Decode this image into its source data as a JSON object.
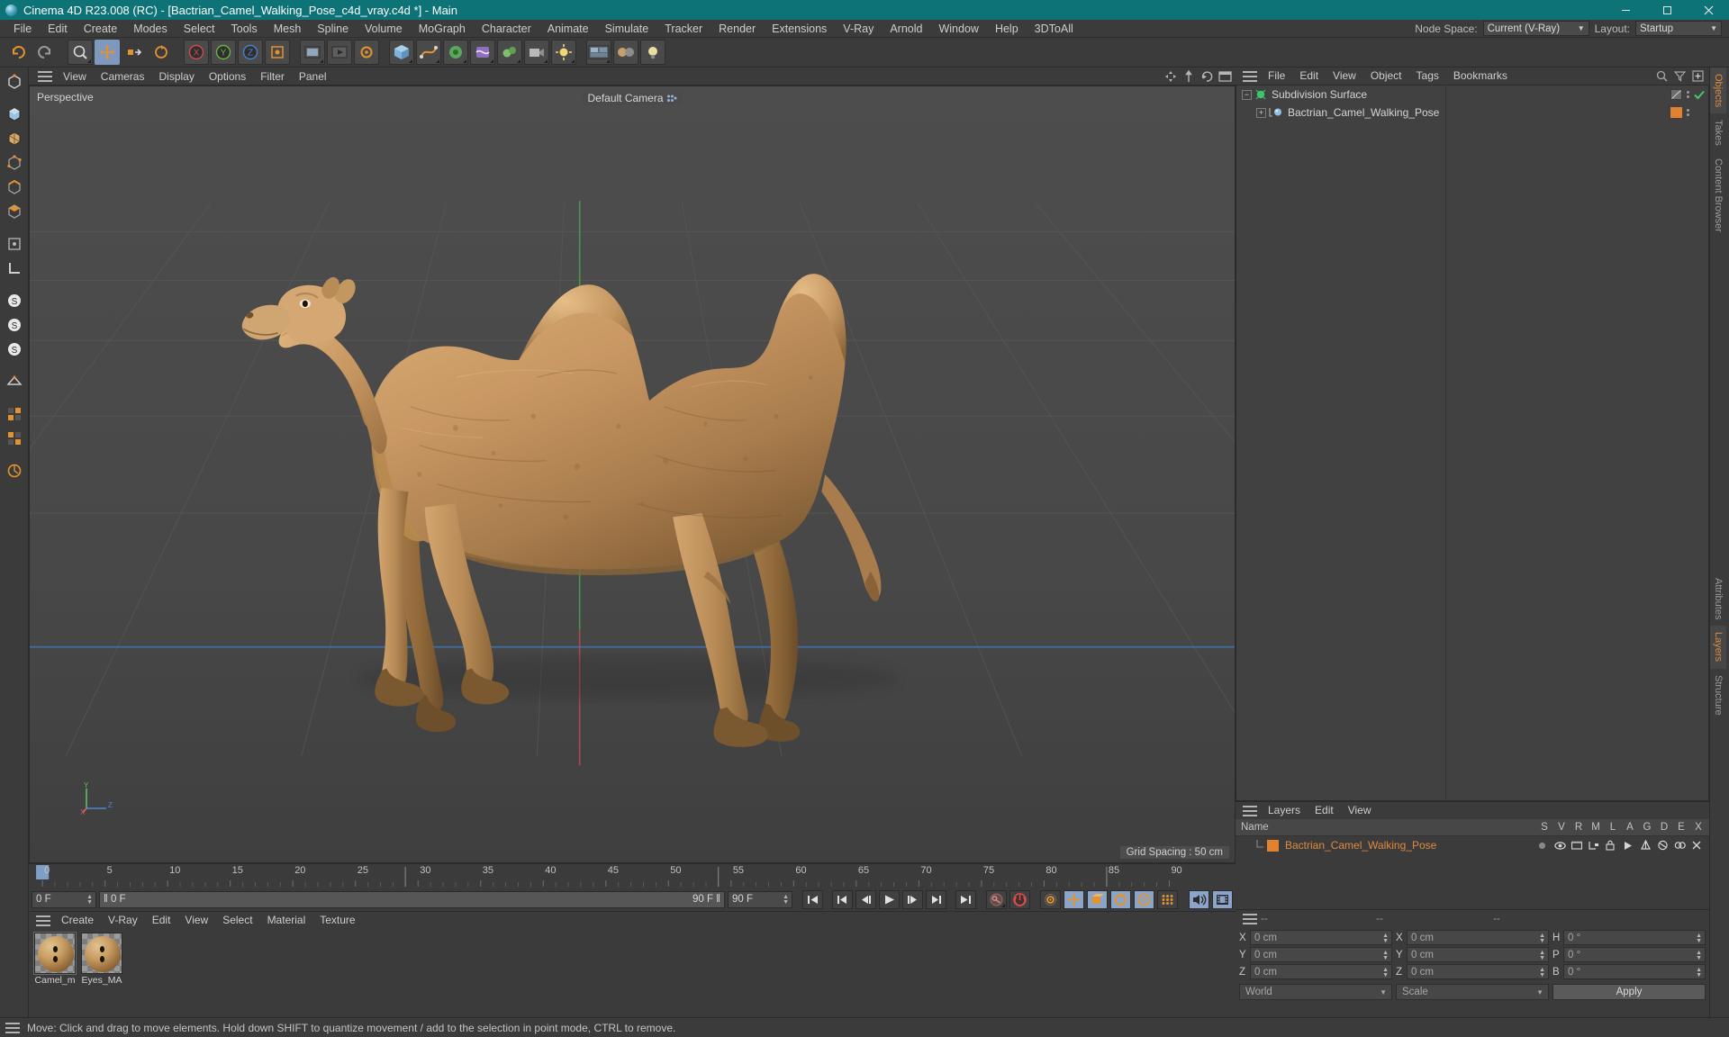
{
  "window": {
    "title": "Cinema 4D R23.008 (RC) - [Bactrian_Camel_Walking_Pose_c4d_vray.c4d *] - Main",
    "minimize": "—",
    "maximize": "▢",
    "close": "✕",
    "accent": "#0d7377"
  },
  "menubar": {
    "items": [
      "File",
      "Edit",
      "Create",
      "Modes",
      "Select",
      "Tools",
      "Mesh",
      "Spline",
      "Volume",
      "MoGraph",
      "Character",
      "Animate",
      "Simulate",
      "Tracker",
      "Render",
      "Extensions",
      "V-Ray",
      "Arnold",
      "Window",
      "Help",
      "3DToAll"
    ],
    "node_space_label": "Node Space:",
    "node_space_value": "Current (V-Ray)",
    "layout_label": "Layout:",
    "layout_value": "Startup"
  },
  "viewport": {
    "menu": [
      "View",
      "Cameras",
      "Display",
      "Options",
      "Filter",
      "Panel"
    ],
    "projection_label": "Perspective",
    "camera_label": "Default Camera",
    "grid_spacing": "Grid Spacing : 50 cm",
    "axis": {
      "x": "X",
      "y": "Y",
      "z": "Z"
    }
  },
  "timeline": {
    "ticks": [
      "0",
      "5",
      "10",
      "15",
      "20",
      "25",
      "30",
      "35",
      "40",
      "45",
      "50",
      "55",
      "60",
      "65",
      "70",
      "75",
      "80",
      "85",
      "90"
    ],
    "current_frame": "0 F",
    "preview_start": "0 F",
    "preview_end": "90 F",
    "end_frame": "90 F",
    "fps_field": "0 F"
  },
  "materials": {
    "menu": [
      "Create",
      "V-Ray",
      "Edit",
      "View",
      "Select",
      "Material",
      "Texture"
    ],
    "items": [
      {
        "name": "Camel_m"
      },
      {
        "name": "Eyes_MA"
      }
    ]
  },
  "objects": {
    "menu": [
      "File",
      "Edit",
      "View",
      "Object",
      "Tags",
      "Bookmarks"
    ],
    "items": [
      {
        "name": "Subdivision Surface",
        "type": "generator",
        "color": "#d5d5d5"
      },
      {
        "name": "Bactrian_Camel_Walking_Pose",
        "type": "polygon",
        "color": "#d5d5d5",
        "tag_color": "#e0822f"
      }
    ]
  },
  "layers": {
    "menu": [
      "Layers",
      "Edit",
      "View"
    ],
    "columns": [
      "Name",
      "S",
      "V",
      "R",
      "M",
      "L",
      "A",
      "G",
      "D",
      "E",
      "X"
    ],
    "rows": [
      {
        "name": "Bactrian_Camel_Walking_Pose",
        "swatch": "#e0822f"
      }
    ]
  },
  "coordinates": {
    "headers": [
      "--",
      "--",
      "--"
    ],
    "position": [
      {
        "label": "X",
        "value": "0 cm"
      },
      {
        "label": "Y",
        "value": "0 cm"
      },
      {
        "label": "Z",
        "value": "0 cm"
      }
    ],
    "size": [
      {
        "label": "X",
        "value": "0 cm"
      },
      {
        "label": "Y",
        "value": "0 cm"
      },
      {
        "label": "Z",
        "value": "0 cm"
      }
    ],
    "rotation": [
      {
        "label": "H",
        "value": "0 °"
      },
      {
        "label": "P",
        "value": "0 °"
      },
      {
        "label": "B",
        "value": "0 °"
      }
    ],
    "space": "World",
    "mode": "Scale",
    "apply": "Apply"
  },
  "right_tabs": {
    "top": [
      "Objects",
      "Takes",
      "Content Browser"
    ],
    "bottom": [
      "Attributes",
      "Layers",
      "Structure"
    ],
    "active_top": "Objects",
    "active_bottom": "Layers"
  },
  "statusbar": {
    "message": "Move: Click and drag to move elements. Hold down SHIFT to quantize movement / add to the selection in point mode, CTRL to remove."
  }
}
